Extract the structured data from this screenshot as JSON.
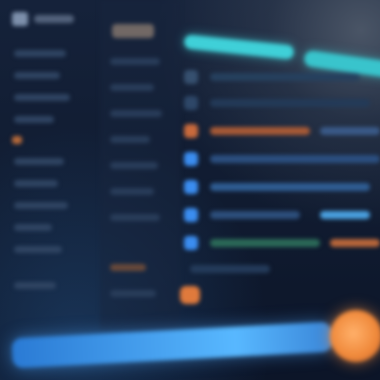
{
  "theme": {
    "accent_teal": "#3fd0d8",
    "accent_blue": "#58b8ff",
    "accent_orange": "#f08a3c",
    "background": "#0f1a2e"
  },
  "sidebar": {
    "logo_icon": "app-logo-icon",
    "item_count": 10
  },
  "middle_column": {
    "item_count": 9
  },
  "main": {
    "tabs": 2,
    "rows": [
      {
        "icon": "row-icon",
        "accent": "#c96a3c"
      },
      {
        "icon": "row-icon",
        "accent": "#3b8df0"
      },
      {
        "icon": "row-icon",
        "accent": "#3b8df0"
      },
      {
        "icon": "row-icon",
        "accent": "#3b8df0"
      },
      {
        "icon": "row-icon",
        "accent": "#3b8df0"
      },
      {
        "icon": "row-icon",
        "accent": "#d07a3a"
      }
    ]
  },
  "fab_icon": "floating-action-icon"
}
